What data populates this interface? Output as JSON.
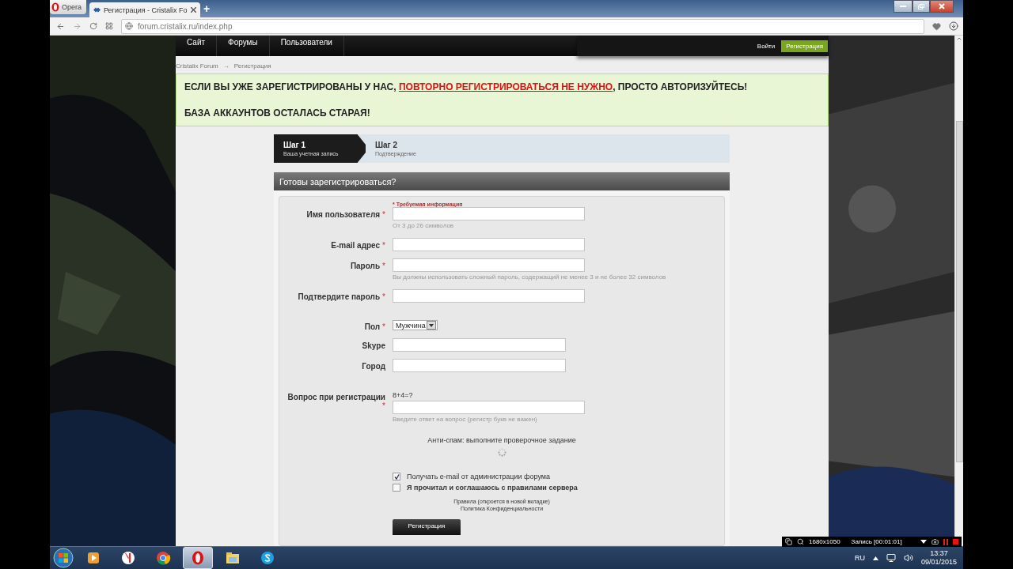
{
  "browser": {
    "menu_button": "Opera",
    "tabs": [
      {
        "title": "Регистрация - Cristalix Fo",
        "selected": true
      }
    ],
    "new_tab": "+",
    "url": "forum.cristalix.ru/index.php"
  },
  "site": {
    "nav": [
      {
        "label": "Сайт"
      },
      {
        "label": "Форумы"
      },
      {
        "label": "Пользователи"
      }
    ],
    "login": "Войти",
    "register": "Регистрация"
  },
  "breadcrumb": {
    "items": [
      "Cristalix Forum",
      "Регистрация"
    ],
    "separator": "→"
  },
  "notice": {
    "line_1": {
      "before": "ЕСЛИ ВЫ УЖЕ ЗАРЕГИСТРИРОВАНЫ У НАС, ",
      "link": "ПОВТОРНО РЕГИСТРИРОВАТЬСЯ НЕ НУЖНО",
      "after": ", ПРОСТО АВТОРИЗУЙТЕСЬ!"
    },
    "line_2": "БАЗА АККАУНТОВ ОСТАЛАСЬ СТАРАЯ!"
  },
  "steps": [
    {
      "title": "Шаг 1",
      "subtitle": "Ваша учетная запись",
      "selected": true
    },
    {
      "title": "Шаг 2",
      "subtitle": "Подтверждение",
      "selected": false
    }
  ],
  "form": {
    "title": "Готовы зарегистрироваться?",
    "required_note": "* Требуемая информация",
    "required_mark": "*",
    "fields": [
      {
        "kind": "text",
        "label": "Имя пользователя",
        "required": true,
        "hint": "От 3 до 26 символов"
      },
      {
        "kind": "text",
        "label": "E-mail адрес",
        "required": true
      },
      {
        "kind": "text",
        "label": "Пароль",
        "required": true,
        "hint": "Вы должны использовать сложный пароль, содержащий не менее 3 и не более 32 символов"
      },
      {
        "kind": "text",
        "label": "Подтвердите пароль",
        "required": true
      },
      {
        "kind": "select",
        "label": "Пол",
        "required": true,
        "value": "Мужчина"
      },
      {
        "kind": "short",
        "label": "Skype",
        "required": false
      },
      {
        "kind": "short",
        "label": "Город",
        "required": false
      },
      {
        "kind": "question",
        "label": "Вопрос при регистрации",
        "required": true,
        "question": "8+4=?",
        "hint": "Введите ответ на вопрос (регистр букв не важен)"
      }
    ],
    "antispam": "Анти-спам: выполните проверочное задание",
    "checkboxes": [
      {
        "label": "Получать e-mail от администрации форума",
        "checked": true,
        "bold": false
      },
      {
        "label": "Я прочитал и соглашаюсь с правилами сервера",
        "checked": false,
        "bold": true
      }
    ],
    "links": [
      "Правила (откроется в новой вкладке)",
      "Политика Конфиденциальности"
    ],
    "submit": "Регистрация"
  },
  "recorder": {
    "resolution": "1680x1050",
    "status": "Запись [00:01:01]"
  },
  "taskbar": {
    "apps": [
      {
        "kind": "media",
        "selected": false
      },
      {
        "kind": "yandex",
        "selected": false
      },
      {
        "kind": "chrome",
        "selected": false
      },
      {
        "kind": "opera",
        "selected": true
      },
      {
        "kind": "folder",
        "selected": false
      },
      {
        "kind": "skype",
        "selected": false
      }
    ],
    "language": "RU",
    "time": "13:37",
    "date": "09/01/2015"
  }
}
